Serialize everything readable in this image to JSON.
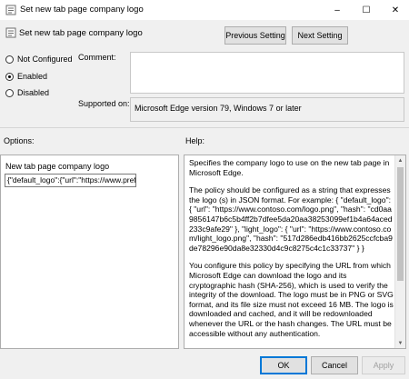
{
  "window": {
    "title": "Set new tab page company logo",
    "minimize": "–",
    "maximize": "☐",
    "close": "✕"
  },
  "header": {
    "title": "Set new tab page company logo",
    "prev_label": "Previous Setting",
    "next_label": "Next Setting"
  },
  "state": {
    "options": [
      "Not Configured",
      "Enabled",
      "Disabled"
    ],
    "selected": "Enabled"
  },
  "comment": {
    "label": "Comment:",
    "value": ""
  },
  "supported": {
    "label": "Supported on:",
    "value": "Microsoft Edge version 79, Windows 7 or later"
  },
  "sections": {
    "options": "Options:",
    "help": "Help:"
  },
  "options_panel": {
    "field_label": "New tab page company logo",
    "field_value": "{\"default_logo\":{\"url\":\"https://www.prefix.eu/"
  },
  "help": {
    "paragraphs": [
      "Specifies the company logo to use on the new tab page in Microsoft Edge.",
      "The policy should be configured as a string that expresses the logo (s) in JSON format. For example: { \"default_logo\": { \"url\": \"https://www.contoso.com/logo.png\", \"hash\": \"cd0aa9856147b6c5b4ff2b7dfee5da20aa38253099ef1b4a64aced233c9afe29\" }, \"light_logo\": { \"url\": \"https://www.contoso.com/light_logo.png\", \"hash\": \"517d286edb416bb2625ccfcba9de78296e90da8e32330d4c9c8275c4c1c33737\" } }",
      "You configure this policy by specifying the URL from which Microsoft Edge can download the logo and its cryptographic hash (SHA-256), which is used to verify the integrity of the download. The logo must be in PNG or SVG format, and its file size must not exceed 16 MB. The logo is downloaded and cached, and it will be redownloaded whenever the URL or the hash changes. The URL must be accessible without any authentication."
    ]
  },
  "footer": {
    "ok": "OK",
    "cancel": "Cancel",
    "apply": "Apply"
  }
}
